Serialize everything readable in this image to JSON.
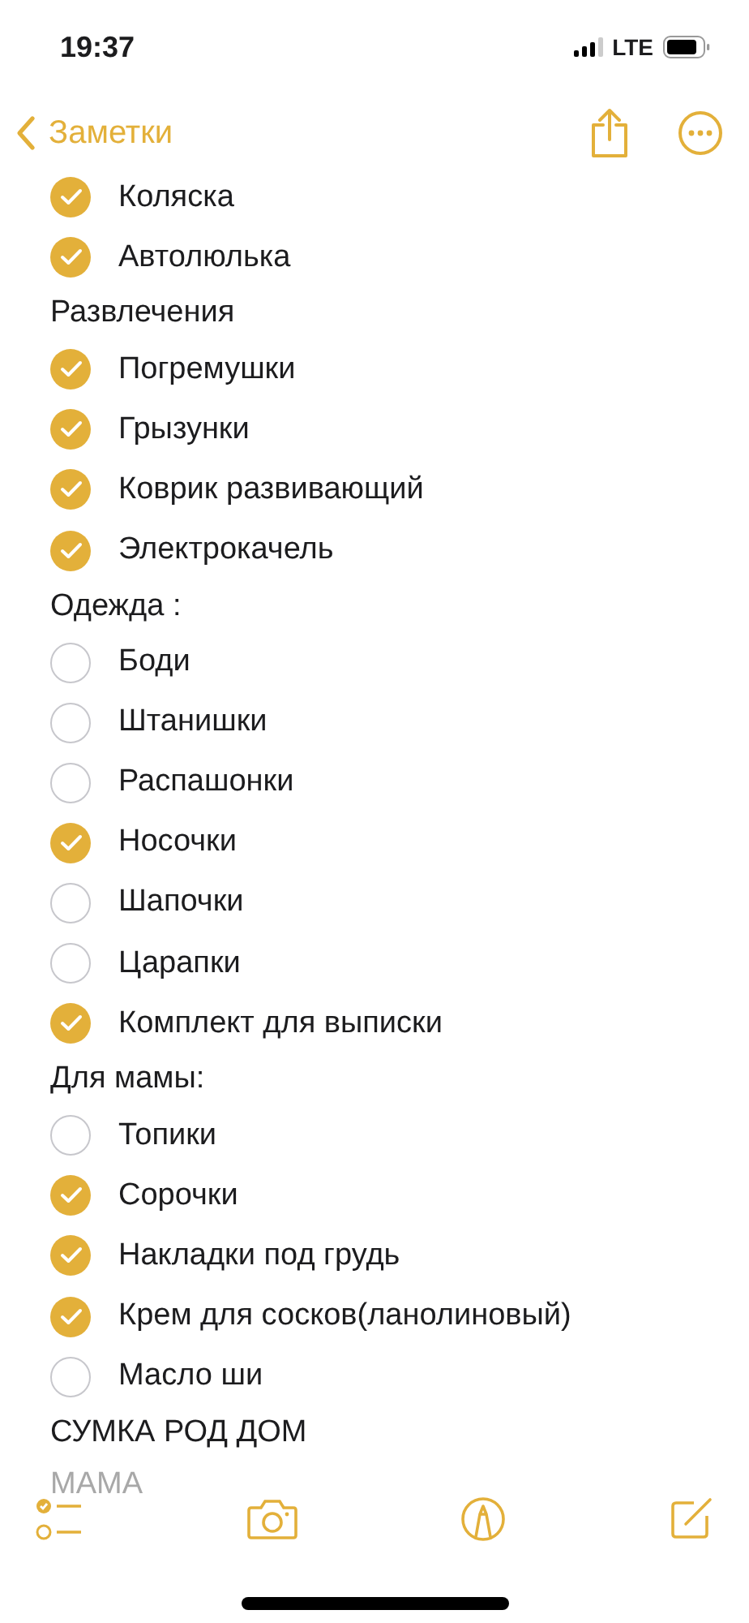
{
  "status_bar": {
    "time": "19:37",
    "network": "LTE"
  },
  "nav": {
    "back_label": "Заметки"
  },
  "lines": [
    {
      "kind": "item",
      "text": "Коляска",
      "checked": true
    },
    {
      "kind": "item",
      "text": "Автолюлька",
      "checked": true
    },
    {
      "kind": "heading",
      "text": "Развлечения",
      "faded": false
    },
    {
      "kind": "item",
      "text": "Погремушки",
      "checked": true
    },
    {
      "kind": "item",
      "text": "Грызунки",
      "checked": true
    },
    {
      "kind": "item",
      "text": "Коврик развивающий",
      "checked": true
    },
    {
      "kind": "item",
      "text": "Электрокачель",
      "checked": true
    },
    {
      "kind": "heading",
      "text": "Одежда :",
      "faded": false
    },
    {
      "kind": "item",
      "text": "Боди",
      "checked": false
    },
    {
      "kind": "item",
      "text": "Штанишки",
      "checked": false
    },
    {
      "kind": "item",
      "text": "Распашонки",
      "checked": false
    },
    {
      "kind": "item",
      "text": "Носочки",
      "checked": true
    },
    {
      "kind": "item",
      "text": "Шапочки",
      "checked": false
    },
    {
      "kind": "item",
      "text": "Царапки",
      "checked": false
    },
    {
      "kind": "item",
      "text": "Комплект для выписки",
      "checked": true
    },
    {
      "kind": "heading",
      "text": "Для мамы:",
      "faded": false
    },
    {
      "kind": "item",
      "text": "Топики",
      "checked": false
    },
    {
      "kind": "item",
      "text": "Сорочки",
      "checked": true
    },
    {
      "kind": "item",
      "text": "Накладки под грудь",
      "checked": true
    },
    {
      "kind": "item",
      "text": "Крем для сосков(ланолиновый)",
      "checked": true
    },
    {
      "kind": "item",
      "text": "Масло ши",
      "checked": false
    },
    {
      "kind": "heading",
      "text": "СУМКА РОД ДОМ",
      "faded": false
    },
    {
      "kind": "heading",
      "text": "МАМА",
      "faded": true
    }
  ]
}
